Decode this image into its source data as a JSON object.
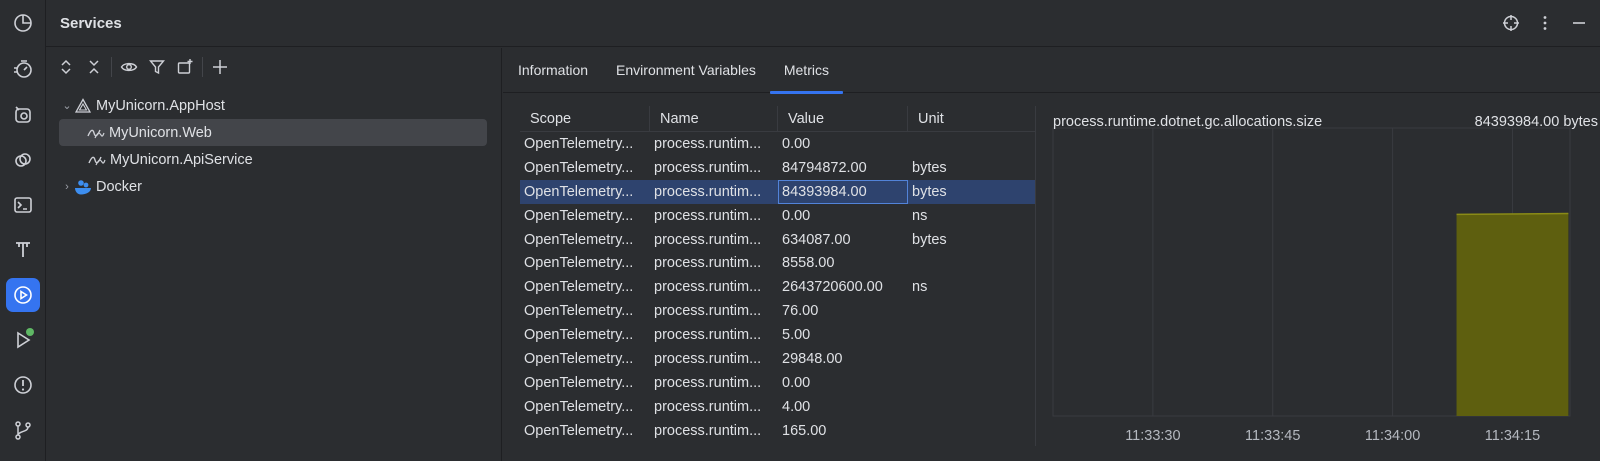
{
  "header": {
    "title": "Services"
  },
  "tree": {
    "items": [
      {
        "label": "MyUnicorn.AppHost",
        "icon": "aspire-host-icon"
      },
      {
        "label": "MyUnicorn.Web",
        "icon": "dotnet-project-icon"
      },
      {
        "label": "MyUnicorn.ApiService",
        "icon": "dotnet-project-icon"
      },
      {
        "label": "Docker",
        "icon": "docker-icon"
      }
    ]
  },
  "tabs": [
    {
      "label": "Information"
    },
    {
      "label": "Environment Variables"
    },
    {
      "label": "Metrics"
    }
  ],
  "table": {
    "headers": [
      "Scope",
      "Name",
      "Value",
      "Unit"
    ],
    "rows": [
      {
        "scope": "OpenTelemetry...",
        "name": "process.runtim...",
        "value": "0.00",
        "unit": ""
      },
      {
        "scope": "OpenTelemetry...",
        "name": "process.runtim...",
        "value": "84794872.00",
        "unit": "bytes"
      },
      {
        "scope": "OpenTelemetry...",
        "name": "process.runtim...",
        "value": "84393984.00",
        "unit": "bytes"
      },
      {
        "scope": "OpenTelemetry...",
        "name": "process.runtim...",
        "value": "0.00",
        "unit": "ns"
      },
      {
        "scope": "OpenTelemetry...",
        "name": "process.runtim...",
        "value": "634087.00",
        "unit": "bytes"
      },
      {
        "scope": "OpenTelemetry...",
        "name": "process.runtim...",
        "value": "8558.00",
        "unit": ""
      },
      {
        "scope": "OpenTelemetry...",
        "name": "process.runtim...",
        "value": "2643720600.00",
        "unit": "ns"
      },
      {
        "scope": "OpenTelemetry...",
        "name": "process.runtim...",
        "value": "76.00",
        "unit": ""
      },
      {
        "scope": "OpenTelemetry...",
        "name": "process.runtim...",
        "value": "5.00",
        "unit": ""
      },
      {
        "scope": "OpenTelemetry...",
        "name": "process.runtim...",
        "value": "29848.00",
        "unit": ""
      },
      {
        "scope": "OpenTelemetry...",
        "name": "process.runtim...",
        "value": "0.00",
        "unit": ""
      },
      {
        "scope": "OpenTelemetry...",
        "name": "process.runtim...",
        "value": "4.00",
        "unit": ""
      },
      {
        "scope": "OpenTelemetry...",
        "name": "process.runtim...",
        "value": "165.00",
        "unit": ""
      }
    ]
  },
  "metric": {
    "name": "process.runtime.dotnet.gc.allocations.size",
    "value": "84393984.00 bytes"
  },
  "chart_data": {
    "type": "area",
    "x_ticks": [
      "11:33:30",
      "11:33:45",
      "11:34:00",
      "11:34:15"
    ],
    "x": [
      "11:34:08",
      "11:34:22"
    ],
    "values": [
      84000000,
      84393984
    ],
    "ylim": [
      0,
      120000000
    ],
    "grid": true,
    "color": "#5e5f0f",
    "line_color": "#8a8b17"
  },
  "colors": {
    "accent": "#3574f0",
    "selected_row": "#2e436e",
    "status_dot": "#5fb865"
  }
}
